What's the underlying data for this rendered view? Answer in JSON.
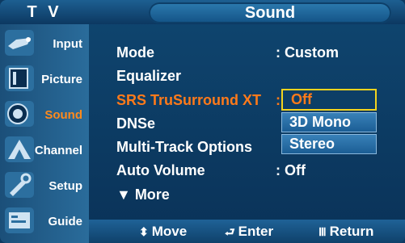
{
  "header": {
    "left": "T V",
    "title": "Sound"
  },
  "sidebar": {
    "items": [
      {
        "label": "Input",
        "icon": "input-icon",
        "active": false
      },
      {
        "label": "Picture",
        "icon": "picture-icon",
        "active": false
      },
      {
        "label": "Sound",
        "icon": "sound-icon",
        "active": true
      },
      {
        "label": "Channel",
        "icon": "channel-icon",
        "active": false
      },
      {
        "label": "Setup",
        "icon": "setup-icon",
        "active": false
      },
      {
        "label": "Guide",
        "icon": "guide-icon",
        "active": false
      }
    ]
  },
  "menu": {
    "rows": [
      {
        "label": "Mode",
        "value": ": Custom"
      },
      {
        "label": "Equalizer",
        "value": ""
      },
      {
        "label": "SRS TruSurround XT",
        "value": ":"
      },
      {
        "label": "DNSe",
        "value": ""
      },
      {
        "label": "Multi-Track Options",
        "value": ""
      },
      {
        "label": "Auto Volume",
        "value": ": Off"
      },
      {
        "label": "▼ More",
        "value": ""
      }
    ],
    "selected_index": 2
  },
  "dropdown": {
    "options": [
      "Off",
      "3D Mono",
      "Stereo"
    ],
    "focused": "Off"
  },
  "footer": {
    "move": "Move",
    "enter": "Enter",
    "return": "Return",
    "move_icon": "updown-arrow-icon",
    "enter_icon": "enter-icon",
    "return_icon": "menu-return-icon"
  },
  "colors": {
    "background": "#0a3258",
    "accent": "#ff7a1a",
    "focus_border": "#f3d31e",
    "text": "#ffffff"
  }
}
